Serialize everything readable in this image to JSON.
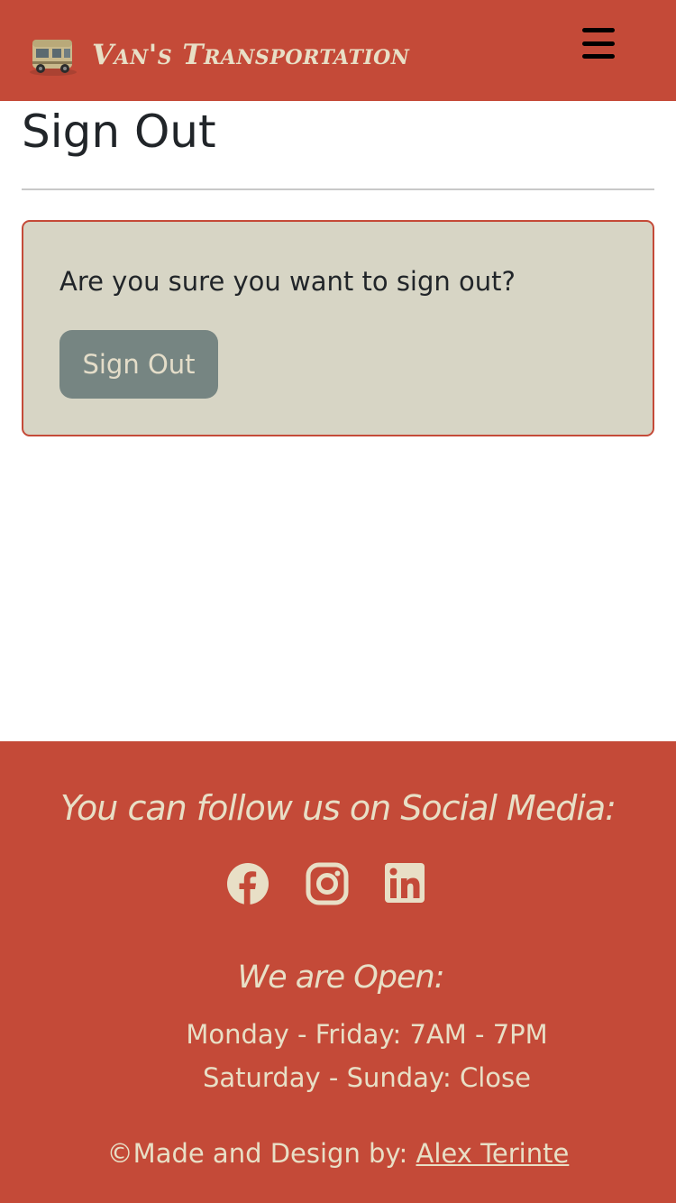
{
  "header": {
    "brand_name": "Van's Transportation",
    "logo_icon": "van-logo-icon",
    "menu_icon": "hamburger-menu-icon"
  },
  "main": {
    "title": "Sign Out",
    "confirm_text": "Are you sure you want to sign out?",
    "signout_button_label": "Sign Out"
  },
  "footer": {
    "social_title": "You can follow us on Social Media:",
    "social_icons": [
      "facebook-icon",
      "instagram-icon",
      "linkedin-icon"
    ],
    "open_title": "We are Open:",
    "hours": [
      "Monday - Friday: 7AM - 7PM",
      "Saturday - Sunday: Close"
    ],
    "credit_prefix": "©Made and Design by: ",
    "credit_name": "Alex Terinte"
  },
  "colors": {
    "header_bg": "#c44a38",
    "footer_bg": "#c44a38",
    "card_bg": "#d7d5c5",
    "card_border": "#c44a38",
    "button_bg": "#768582",
    "light_text": "#e8dfc6"
  }
}
